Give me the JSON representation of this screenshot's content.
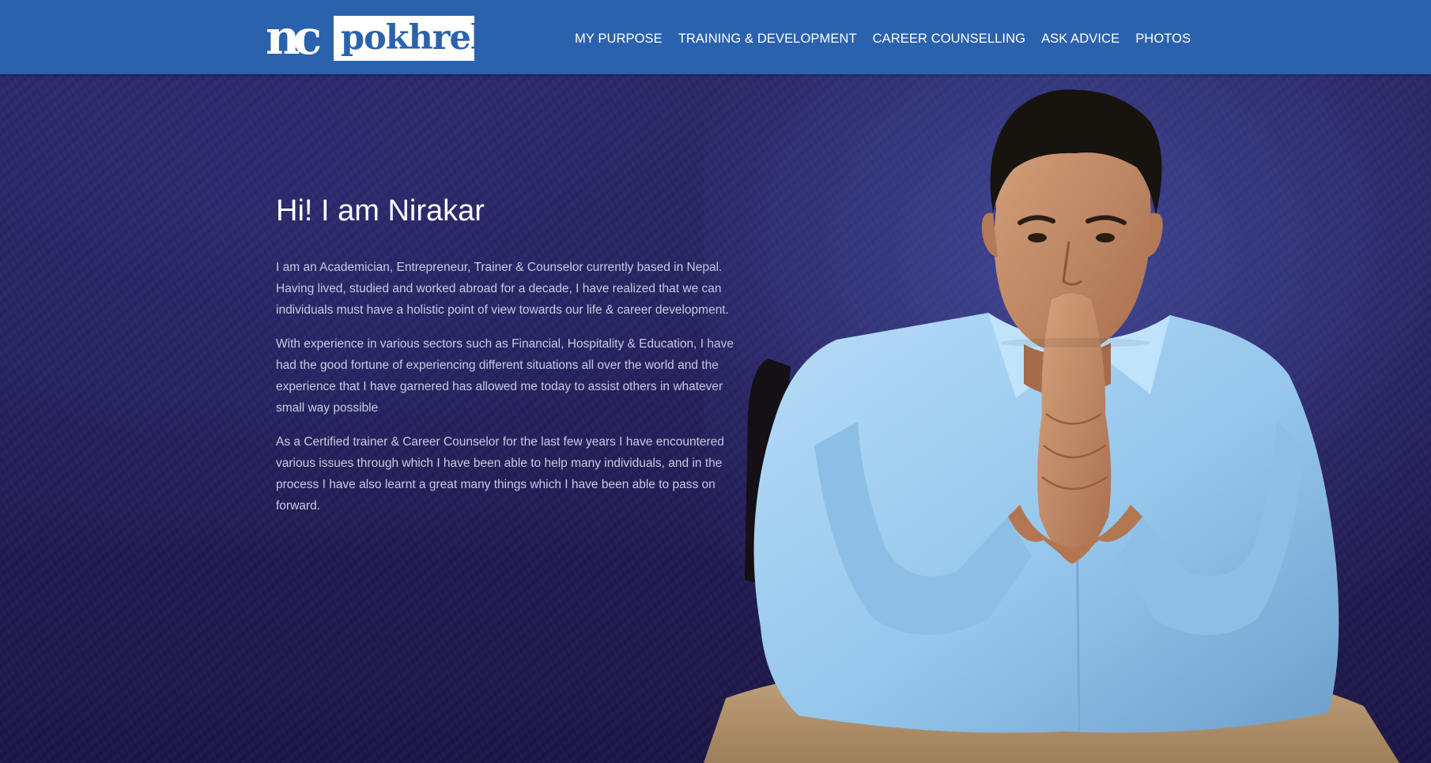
{
  "brand": {
    "logo_mark": "nc",
    "logo_word": "pokhrel"
  },
  "nav": {
    "items": [
      {
        "label": "MY PURPOSE"
      },
      {
        "label": "TRAINING & DEVELOPMENT"
      },
      {
        "label": "CAREER COUNSELLING"
      },
      {
        "label": "ASK ADVICE"
      },
      {
        "label": "PHOTOS"
      }
    ]
  },
  "hero": {
    "title": "Hi! I am Nirakar",
    "paragraphs": [
      "I am an Academician, Entrepreneur, Trainer & Counselor currently based in Nepal. Having lived, studied and worked abroad for a decade, I have realized that we can individuals must have a holistic point of view towards our life & career development.",
      "With experience in various sectors such as Financial, Hospitality & Education, I have had the good fortune of experiencing different situations all over the world and the experience that I have garnered has allowed me today to assist others in whatever small way possible",
      "As a Certified trainer & Career Counselor for the last few years I have encountered various issues through which I have been able to help many individuals, and in the process I have also learnt a great many things which I have been able to pass on forward."
    ]
  },
  "colors": {
    "header_bg": "#2b62ad",
    "hero_bg": "#25205c",
    "text_primary": "#ffffff",
    "text_secondary": "#c9cbe3",
    "shirt": "#9ccbee",
    "skin": "#c58d6a"
  }
}
